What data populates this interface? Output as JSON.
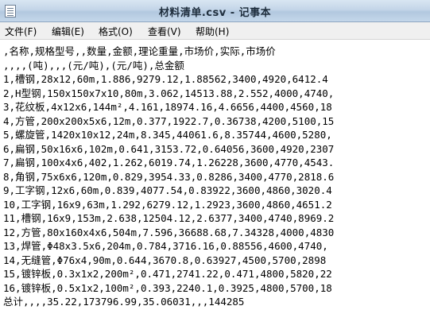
{
  "window": {
    "title": "材料清单.csv - 记事本"
  },
  "menu": [
    {
      "label": "文件(F)"
    },
    {
      "label": "编辑(E)"
    },
    {
      "label": "格式(O)"
    },
    {
      "label": "查看(V)"
    },
    {
      "label": "帮助(H)"
    }
  ],
  "lines": [
    ",名称,规格型号,,数量,金额,理论重量,市场价,实际,市场价",
    ",,,,(吨),,,(元/吨),(元/吨),总金额",
    "1,槽钢,28x12,60m,1.886,9279.12,1.88562,3400,4920,6412.4",
    "2,H型钢,150x150x7x10,80m,3.062,14513.88,2.552,4000,4740,",
    "3,花纹板,4x12x6,144m²,4.161,18974.16,4.6656,4400,4560,18",
    "4,方管,200x200x5x6,12m,0.377,1922.7,0.36738,4200,5100,15",
    "5,螺旋管,1420x10x12,24m,8.345,44061.6,8.35744,4600,5280,",
    "6,扁钢,50x16x6,102m,0.641,3153.72,0.64056,3600,4920,2307",
    "7,扁钢,100x4x6,402,1.262,6019.74,1.26228,3600,4770,4543.",
    "8,角钢,75x6x6,120m,0.829,3954.33,0.8286,3400,4770,2818.6",
    "9,工字钢,12x6,60m,0.839,4077.54,0.83922,3600,4860,3020.4",
    "10,工字钢,16x9,63m,1.292,6279.12,1.2923,3600,4860,4651.2",
    "11,槽钢,16x9,153m,2.638,12504.12,2.6377,3400,4740,8969.2",
    "12,方管,80x160x4x6,504m,7.596,36688.68,7.34328,4000,4830",
    "13,焊管,Φ48x3.5x6,204m,0.784,3716.16,0.88556,4600,4740,",
    "14,无缝管,Φ76x4,90m,0.644,3670.8,0.63927,4500,5700,2898",
    "15,镀锌板,0.3x1x2,200m²,0.471,2741.22,0.471,4800,5820,22",
    "16,镀锌板,0.5x1x2,100m²,0.393,2240.1,0.3925,4800,5700,18",
    "总计,,,,35.22,173796.99,35.06031,,,144285"
  ]
}
